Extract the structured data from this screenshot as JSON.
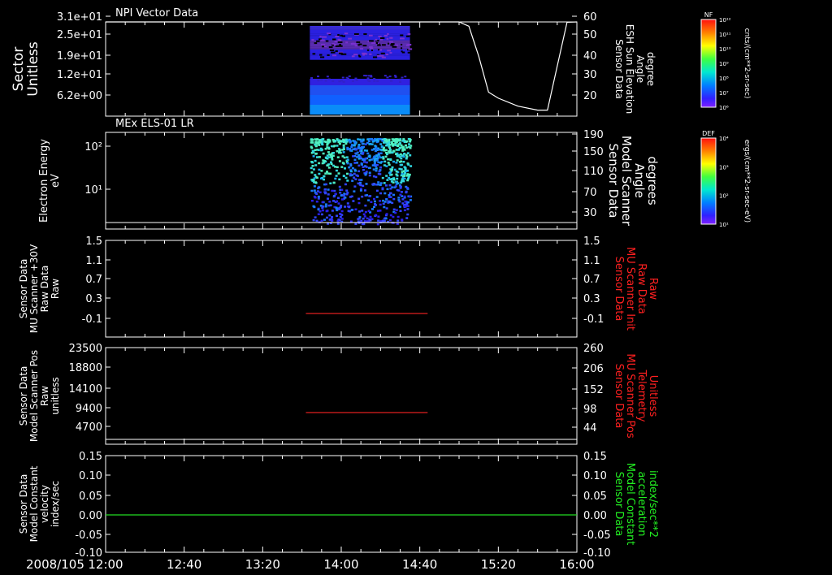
{
  "x_axis": {
    "date_label": "2008/105",
    "ticks": [
      "12:00",
      "12:40",
      "13:20",
      "14:00",
      "14:40",
      "15:20",
      "16:00"
    ]
  },
  "panels": [
    {
      "title": "NPI Vector Data",
      "left_label": [
        "Sector",
        "Unitless"
      ],
      "right_label": [
        "Sensor Data",
        "ESH Sun Elevation",
        "Angle",
        "degree"
      ],
      "right_label_color": "#ffffff",
      "left_ticks": [
        "3.1e+01",
        "2.5e+01",
        "1.9e+01",
        "1.2e+01",
        "6.2e+00"
      ],
      "right_ticks": [
        "60",
        "50",
        "40",
        "30",
        "20"
      ],
      "colorbar": {
        "title": "NF",
        "label": "cnts/(cm**2-sr-sec)",
        "ticks": [
          "10¹²",
          "10¹¹",
          "10¹⁰",
          "10⁹",
          "10⁸",
          "10⁷",
          "10⁶"
        ]
      }
    },
    {
      "title": "MEx ELS-01 LR",
      "left_label": [
        "Electron Energy",
        "eV"
      ],
      "right_label": [
        "Sensor Data",
        "Model Scanner",
        "Angle",
        "degrees"
      ],
      "right_label_color": "#ffffff",
      "left_ticks": [
        "10²",
        "10¹"
      ],
      "right_ticks": [
        "190",
        "150",
        "110",
        "70",
        "30"
      ],
      "colorbar": {
        "title": "DEF",
        "label": "ergs/(cm**2-sr-sec-eV)",
        "ticks": [
          "10⁴",
          "10³",
          "10²",
          "10¹"
        ]
      }
    },
    {
      "left_label": [
        "Sensor Data",
        "MU Scanner +30V",
        "Raw Data",
        "Raw"
      ],
      "right_label": [
        "Sensor Data",
        "MU Scanner Init",
        "Raw Data",
        "Raw"
      ],
      "right_label_color": "#ff2020",
      "left_ticks": [
        "1.5",
        "1.1",
        "0.7",
        "0.3",
        "-0.1"
      ],
      "right_ticks": [
        "1.5",
        "1.1",
        "0.7",
        "0.3",
        "-0.1"
      ]
    },
    {
      "left_label": [
        "Sensor Data",
        "Model Scanner Pos",
        "Raw",
        "unitless"
      ],
      "right_label": [
        "Sensor Data",
        "MU Scanner Pos",
        "Telemetry",
        "Unitless"
      ],
      "right_label_color": "#ff2020",
      "left_ticks": [
        "23500",
        "18800",
        "14100",
        "9400",
        "4700"
      ],
      "right_ticks": [
        "260",
        "206",
        "152",
        "98",
        "44"
      ]
    },
    {
      "left_label": [
        "Sensor Data",
        "Model Constant",
        "velocity",
        "index/sec"
      ],
      "right_label": [
        "Sensor Data",
        "Model Constant",
        "acceleration",
        "index/sec**2"
      ],
      "right_label_color": "#22ee22",
      "left_ticks": [
        "0.15",
        "0.10",
        "0.05",
        "0.00",
        "-0.05",
        "-0.10"
      ],
      "right_ticks": [
        "0.15",
        "0.10",
        "0.05",
        "0.00",
        "-0.05",
        "-0.10"
      ]
    }
  ],
  "chart_data": [
    {
      "type": "line",
      "title": "NPI Vector Data",
      "ylabel": "Sensor Data ESH Sun Elevation Angle degree",
      "ylim": [
        10,
        60
      ],
      "x": [
        "12:00",
        "14:50",
        "15:00",
        "15:05",
        "15:10",
        "15:15",
        "15:20",
        "15:30",
        "15:40",
        "15:45",
        "15:50",
        "15:55",
        "16:00"
      ],
      "values": [
        58,
        58,
        59,
        55,
        40,
        22,
        19,
        15,
        13,
        13,
        35,
        57,
        58
      ]
    },
    {
      "type": "heatmap",
      "title": "NPI Vector Data",
      "ylabel": "Sector Unitless",
      "x_range": [
        "13:44",
        "14:35"
      ],
      "y_bands": [
        [
          22.5,
          31
        ],
        [
          0,
          12
        ]
      ]
    },
    {
      "type": "heatmap",
      "title": "MEx ELS-01 LR",
      "ylabel": "Electron Energy eV",
      "x_range": [
        "13:44",
        "14:35"
      ],
      "y_range": [
        1,
        150
      ]
    },
    {
      "type": "line",
      "ylabel": "Sensor Data MU Scanner +30V Raw Data Raw",
      "ylim": [
        -0.3,
        1.5
      ],
      "x": [
        "13:42",
        "14:44"
      ],
      "values": [
        0,
        0
      ],
      "color": "#e02020"
    },
    {
      "type": "line",
      "ylabel": "Sensor Data Model Scanner Pos Raw unitless",
      "ylim": [
        0,
        23500
      ],
      "x": [
        "13:42",
        "14:44"
      ],
      "values": [
        7600,
        7600
      ],
      "color": "#e02020"
    },
    {
      "type": "line",
      "ylabel": "Sensor Data Model Constant velocity index/sec",
      "ylim": [
        -0.1,
        0.15
      ],
      "x": [
        "12:00",
        "16:00"
      ],
      "values": [
        0,
        0
      ],
      "color": "#22dd22"
    }
  ]
}
